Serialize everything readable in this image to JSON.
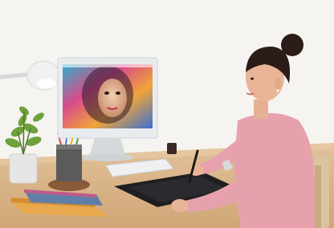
{
  "scene": {
    "description_hidden": "",
    "colors": {
      "background": "#f6f4f1",
      "desk": "#d9b58c",
      "desk_edge": "#c79e73",
      "monitor_frame": "#e9ecee",
      "monitor_stand": "#d6d9dc",
      "tablet": "#1f1f22",
      "sweater": "#e7a1ad",
      "skin": "#e9b597",
      "hair": "#2b1c17",
      "chair": "#dcc3a0",
      "lamp": "#eeeeee",
      "pot": "#e7e7e7",
      "pencil_cup": "#5a5a5a",
      "book_blue": "#5f7fa6",
      "book_orange": "#e6a24a"
    }
  }
}
